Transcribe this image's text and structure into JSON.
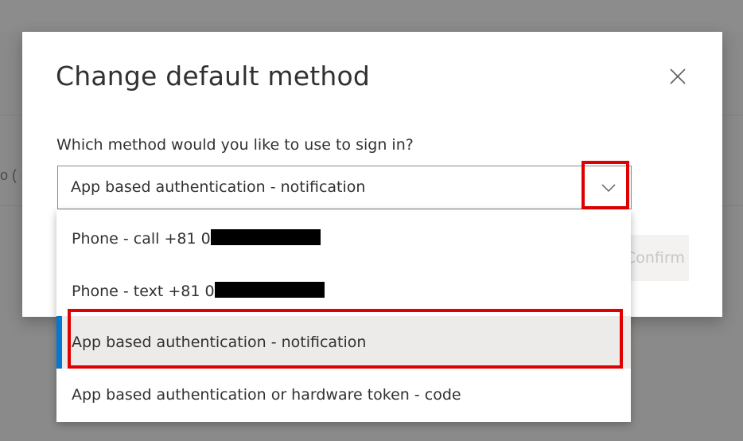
{
  "dialog": {
    "title": "Change default method",
    "question": "Which method would you like to use to sign in?",
    "selected_value": "App based authentication - notification",
    "confirm_label": "Confirm"
  },
  "background": {
    "partial_text": "o ("
  },
  "dropdown": {
    "options": [
      {
        "prefix": "Phone - call +81 0",
        "redacted": true
      },
      {
        "prefix": "Phone - text +81 0",
        "redacted": true
      },
      {
        "label": "App based authentication - notification",
        "selected": true
      },
      {
        "label": "App based authentication or hardware token - code"
      }
    ]
  },
  "colors": {
    "accent": "#0078d4",
    "highlight_red": "#e00000",
    "overlay": "#8a8a8a"
  },
  "icons": {
    "close": "close-icon",
    "chevron": "chevron-down-icon"
  }
}
